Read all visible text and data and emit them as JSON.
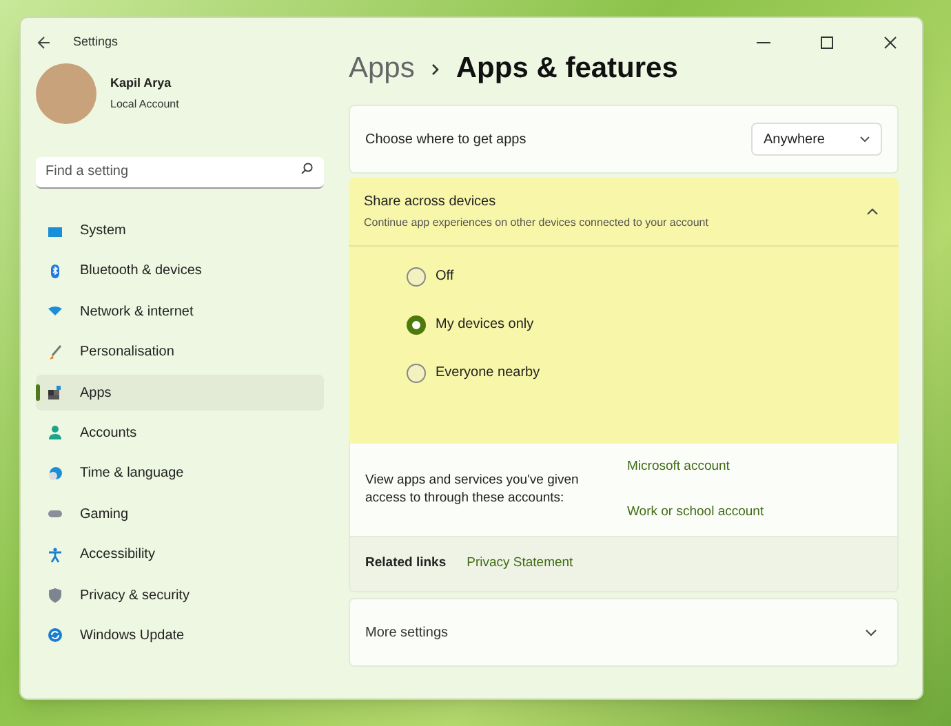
{
  "window": {
    "title": "Settings"
  },
  "account": {
    "name": "Kapil Arya",
    "type": "Local Account"
  },
  "search": {
    "placeholder": "Find a setting"
  },
  "sidebar": {
    "items": [
      {
        "label": "System",
        "selected": false
      },
      {
        "label": "Bluetooth & devices",
        "selected": false
      },
      {
        "label": "Network & internet",
        "selected": false
      },
      {
        "label": "Personalisation",
        "selected": false
      },
      {
        "label": "Apps",
        "selected": true
      },
      {
        "label": "Accounts",
        "selected": false
      },
      {
        "label": "Time & language",
        "selected": false
      },
      {
        "label": "Gaming",
        "selected": false
      },
      {
        "label": "Accessibility",
        "selected": false
      },
      {
        "label": "Privacy & security",
        "selected": false
      },
      {
        "label": "Windows Update",
        "selected": false
      }
    ]
  },
  "breadcrumb": [
    "Apps",
    "Apps & features"
  ],
  "get_apps": {
    "label": "Choose where to get apps",
    "value": "Anywhere"
  },
  "share": {
    "title": "Share across devices",
    "subtitle": "Continue app experiences on other devices connected to your account",
    "expanded": true,
    "options": [
      {
        "label": "Off",
        "selected": false
      },
      {
        "label": "My devices only",
        "selected": true
      },
      {
        "label": "Everyone nearby",
        "selected": false
      }
    ]
  },
  "accounts_access": {
    "text": "View apps and services you've given access to through these accounts:",
    "links": [
      "Microsoft account",
      "Work or school account"
    ]
  },
  "related": {
    "label": "Related links",
    "links": [
      "Privacy Statement"
    ]
  },
  "more_settings": {
    "label": "More settings",
    "expanded": false
  }
}
